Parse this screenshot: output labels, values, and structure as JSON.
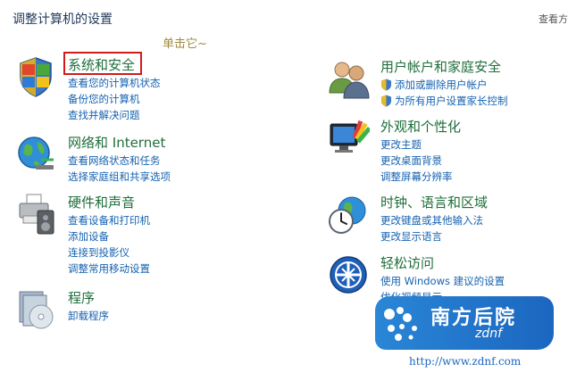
{
  "header": {
    "title": "调整计算机的设置",
    "view_by": "查看方"
  },
  "annotation_text": "单击它~",
  "categories": [
    {
      "title": "系统和安全",
      "icon": "shield-flag-icon",
      "links": [
        "查看您的计算机状态",
        "备份您的计算机",
        "查找并解决问题"
      ]
    },
    {
      "title": "网络和 Internet",
      "icon": "globe-network-icon",
      "links": [
        "查看网络状态和任务",
        "选择家庭组和共享选项"
      ]
    },
    {
      "title": "硬件和声音",
      "icon": "printer-speaker-icon",
      "links": [
        "查看设备和打印机",
        "添加设备",
        "连接到投影仪",
        "调整常用移动设置"
      ]
    },
    {
      "title": "程序",
      "icon": "programs-disc-icon",
      "links": [
        "卸载程序"
      ]
    },
    {
      "title": "用户帐户和家庭安全",
      "icon": "users-icon",
      "links": [
        "添加或删除用户帐户",
        "为所有用户设置家长控制"
      ]
    },
    {
      "title": "外观和个性化",
      "icon": "monitor-palette-icon",
      "links": [
        "更改主题",
        "更改桌面背景",
        "调整屏幕分辨率"
      ]
    },
    {
      "title": "时钟、语言和区域",
      "icon": "clock-globe-icon",
      "links": [
        "更改键盘或其他输入法",
        "更改显示语言"
      ]
    },
    {
      "title": "轻松访问",
      "icon": "ease-of-access-icon",
      "links": [
        "使用 Windows 建议的设置",
        "优化视频显示"
      ]
    }
  ],
  "watermark": {
    "main": "南方后院",
    "sub": "zdnf",
    "url": "http://www.zdnf.com"
  },
  "colors": {
    "title_green": "#1f6e3b",
    "link_blue": "#1562b0",
    "highlight_red": "#d11b1b"
  }
}
